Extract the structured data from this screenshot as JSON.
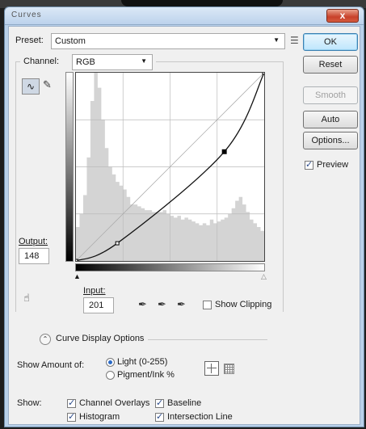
{
  "window": {
    "title": "Curves",
    "close_label": "x"
  },
  "preset": {
    "label": "Preset:",
    "value": "Custom",
    "menu_icon": "preset-options-icon"
  },
  "channel": {
    "label": "Channel:",
    "value": "RGB"
  },
  "buttons": {
    "ok": "OK",
    "reset": "Reset",
    "smooth": "Smooth",
    "auto": "Auto",
    "options": "Options..."
  },
  "preview": {
    "label": "Preview",
    "checked": true
  },
  "output": {
    "label": "Output:",
    "value": "148"
  },
  "input": {
    "label": "Input:",
    "value": "201"
  },
  "show_clipping": {
    "label": "Show Clipping",
    "checked": false
  },
  "curve_display_options": {
    "label": "Curve Display Options"
  },
  "show_amount": {
    "label": "Show Amount of:",
    "options": [
      {
        "label": "Light  (0-255)",
        "selected": true
      },
      {
        "label": "Pigment/Ink %",
        "selected": false
      }
    ]
  },
  "show": {
    "label": "Show:",
    "channel_overlays": {
      "label": "Channel Overlays",
      "checked": true
    },
    "baseline": {
      "label": "Baseline",
      "checked": true
    },
    "histogram": {
      "label": "Histogram",
      "checked": true
    },
    "intersection_line": {
      "label": "Intersection Line",
      "checked": true
    }
  },
  "chart_data": {
    "type": "line",
    "x_range": [
      0,
      255
    ],
    "y_range": [
      0,
      255
    ],
    "grid_divisions": 4,
    "curve_points": [
      [
        0,
        0
      ],
      [
        56,
        24
      ],
      [
        201,
        148
      ],
      [
        255,
        255
      ]
    ],
    "histogram_bins": [
      0.18,
      0.25,
      0.35,
      0.55,
      0.85,
      1.0,
      0.92,
      0.75,
      0.6,
      0.5,
      0.46,
      0.42,
      0.4,
      0.38,
      0.34,
      0.3,
      0.3,
      0.29,
      0.28,
      0.27,
      0.27,
      0.26,
      0.26,
      0.26,
      0.27,
      0.25,
      0.24,
      0.23,
      0.24,
      0.22,
      0.23,
      0.22,
      0.21,
      0.2,
      0.19,
      0.2,
      0.19,
      0.22,
      0.2,
      0.21,
      0.22,
      0.23,
      0.25,
      0.28,
      0.32,
      0.34,
      0.3,
      0.26,
      0.22,
      0.2,
      0.18,
      0.16
    ]
  }
}
